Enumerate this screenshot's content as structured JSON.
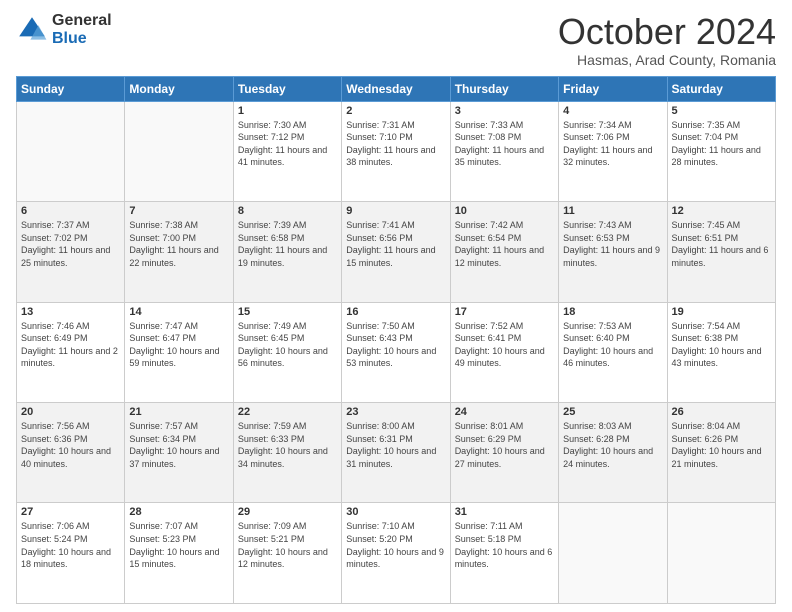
{
  "header": {
    "logo_general": "General",
    "logo_blue": "Blue",
    "month_title": "October 2024",
    "location": "Hasmas, Arad County, Romania"
  },
  "days_of_week": [
    "Sunday",
    "Monday",
    "Tuesday",
    "Wednesday",
    "Thursday",
    "Friday",
    "Saturday"
  ],
  "weeks": [
    [
      {
        "day": "",
        "info": ""
      },
      {
        "day": "",
        "info": ""
      },
      {
        "day": "1",
        "info": "Sunrise: 7:30 AM\nSunset: 7:12 PM\nDaylight: 11 hours and 41 minutes."
      },
      {
        "day": "2",
        "info": "Sunrise: 7:31 AM\nSunset: 7:10 PM\nDaylight: 11 hours and 38 minutes."
      },
      {
        "day": "3",
        "info": "Sunrise: 7:33 AM\nSunset: 7:08 PM\nDaylight: 11 hours and 35 minutes."
      },
      {
        "day": "4",
        "info": "Sunrise: 7:34 AM\nSunset: 7:06 PM\nDaylight: 11 hours and 32 minutes."
      },
      {
        "day": "5",
        "info": "Sunrise: 7:35 AM\nSunset: 7:04 PM\nDaylight: 11 hours and 28 minutes."
      }
    ],
    [
      {
        "day": "6",
        "info": "Sunrise: 7:37 AM\nSunset: 7:02 PM\nDaylight: 11 hours and 25 minutes."
      },
      {
        "day": "7",
        "info": "Sunrise: 7:38 AM\nSunset: 7:00 PM\nDaylight: 11 hours and 22 minutes."
      },
      {
        "day": "8",
        "info": "Sunrise: 7:39 AM\nSunset: 6:58 PM\nDaylight: 11 hours and 19 minutes."
      },
      {
        "day": "9",
        "info": "Sunrise: 7:41 AM\nSunset: 6:56 PM\nDaylight: 11 hours and 15 minutes."
      },
      {
        "day": "10",
        "info": "Sunrise: 7:42 AM\nSunset: 6:54 PM\nDaylight: 11 hours and 12 minutes."
      },
      {
        "day": "11",
        "info": "Sunrise: 7:43 AM\nSunset: 6:53 PM\nDaylight: 11 hours and 9 minutes."
      },
      {
        "day": "12",
        "info": "Sunrise: 7:45 AM\nSunset: 6:51 PM\nDaylight: 11 hours and 6 minutes."
      }
    ],
    [
      {
        "day": "13",
        "info": "Sunrise: 7:46 AM\nSunset: 6:49 PM\nDaylight: 11 hours and 2 minutes."
      },
      {
        "day": "14",
        "info": "Sunrise: 7:47 AM\nSunset: 6:47 PM\nDaylight: 10 hours and 59 minutes."
      },
      {
        "day": "15",
        "info": "Sunrise: 7:49 AM\nSunset: 6:45 PM\nDaylight: 10 hours and 56 minutes."
      },
      {
        "day": "16",
        "info": "Sunrise: 7:50 AM\nSunset: 6:43 PM\nDaylight: 10 hours and 53 minutes."
      },
      {
        "day": "17",
        "info": "Sunrise: 7:52 AM\nSunset: 6:41 PM\nDaylight: 10 hours and 49 minutes."
      },
      {
        "day": "18",
        "info": "Sunrise: 7:53 AM\nSunset: 6:40 PM\nDaylight: 10 hours and 46 minutes."
      },
      {
        "day": "19",
        "info": "Sunrise: 7:54 AM\nSunset: 6:38 PM\nDaylight: 10 hours and 43 minutes."
      }
    ],
    [
      {
        "day": "20",
        "info": "Sunrise: 7:56 AM\nSunset: 6:36 PM\nDaylight: 10 hours and 40 minutes."
      },
      {
        "day": "21",
        "info": "Sunrise: 7:57 AM\nSunset: 6:34 PM\nDaylight: 10 hours and 37 minutes."
      },
      {
        "day": "22",
        "info": "Sunrise: 7:59 AM\nSunset: 6:33 PM\nDaylight: 10 hours and 34 minutes."
      },
      {
        "day": "23",
        "info": "Sunrise: 8:00 AM\nSunset: 6:31 PM\nDaylight: 10 hours and 31 minutes."
      },
      {
        "day": "24",
        "info": "Sunrise: 8:01 AM\nSunset: 6:29 PM\nDaylight: 10 hours and 27 minutes."
      },
      {
        "day": "25",
        "info": "Sunrise: 8:03 AM\nSunset: 6:28 PM\nDaylight: 10 hours and 24 minutes."
      },
      {
        "day": "26",
        "info": "Sunrise: 8:04 AM\nSunset: 6:26 PM\nDaylight: 10 hours and 21 minutes."
      }
    ],
    [
      {
        "day": "27",
        "info": "Sunrise: 7:06 AM\nSunset: 5:24 PM\nDaylight: 10 hours and 18 minutes."
      },
      {
        "day": "28",
        "info": "Sunrise: 7:07 AM\nSunset: 5:23 PM\nDaylight: 10 hours and 15 minutes."
      },
      {
        "day": "29",
        "info": "Sunrise: 7:09 AM\nSunset: 5:21 PM\nDaylight: 10 hours and 12 minutes."
      },
      {
        "day": "30",
        "info": "Sunrise: 7:10 AM\nSunset: 5:20 PM\nDaylight: 10 hours and 9 minutes."
      },
      {
        "day": "31",
        "info": "Sunrise: 7:11 AM\nSunset: 5:18 PM\nDaylight: 10 hours and 6 minutes."
      },
      {
        "day": "",
        "info": ""
      },
      {
        "day": "",
        "info": ""
      }
    ]
  ]
}
